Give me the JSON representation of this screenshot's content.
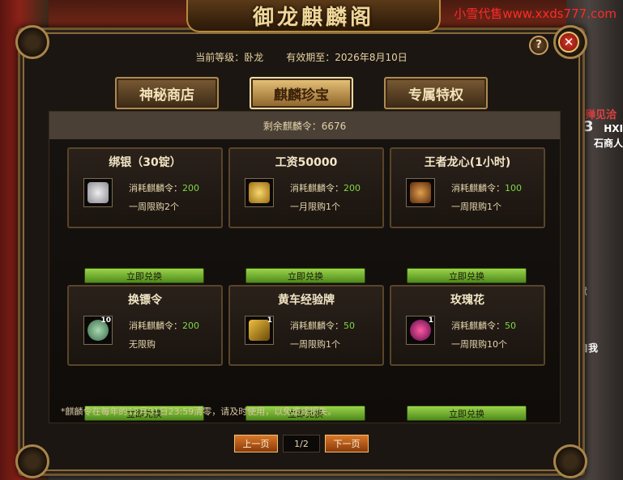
{
  "watermark": "小雪代售www.xxds777.com",
  "title": "御龙麒麟阁",
  "side_texts": {
    "t1": "殚见洽",
    "t2": "HXI",
    "t3": "石商人",
    "t4": "3",
    "t5": "自我",
    "t6": "意"
  },
  "header": {
    "level_label": "当前等级：卧龙",
    "expiry_label": "有效期至：2026年8月10日",
    "help": "?",
    "close": "✕"
  },
  "tabs": [
    "神秘商店",
    "麒麟珍宝",
    "专属特权"
  ],
  "active_tab": 1,
  "remaining": "剩余麒麟令：6676",
  "cost_prefix": "消耗麒麟令：",
  "exchange_label": "立即兑换",
  "items": [
    {
      "name": "绑银（30锭）",
      "cost": "200",
      "limit": "一周限购2个",
      "icon": "silver-ingot-icon",
      "color": "#b8b8c0",
      "count": ""
    },
    {
      "name": "工资50000",
      "cost": "200",
      "limit": "一月限购1个",
      "icon": "wage-icon",
      "color": "#d8a23a",
      "count": ""
    },
    {
      "name": "王者龙心(1小时)",
      "cost": "100",
      "limit": "一周限购1个",
      "icon": "dragon-heart-icon",
      "color": "#b06a2a",
      "count": ""
    },
    {
      "name": "换镖令",
      "cost": "200",
      "limit": "无限购",
      "icon": "escort-token-icon",
      "color": "#6aa07a",
      "count": "10"
    },
    {
      "name": "黄车经验牌",
      "cost": "50",
      "limit": "一周限购1个",
      "icon": "cart-exp-icon",
      "color": "#c09020",
      "count": "1"
    },
    {
      "name": "玫瑰花",
      "cost": "50",
      "limit": "一周限购10个",
      "icon": "rose-icon",
      "color": "#c02a8a",
      "count": "1"
    }
  ],
  "footnote": "*麒麟令在每年的12月31日23:59清零，请及时使用，以免造成损失。",
  "pager": {
    "prev": "上一页",
    "indicator": "1/2",
    "next": "下一页"
  }
}
